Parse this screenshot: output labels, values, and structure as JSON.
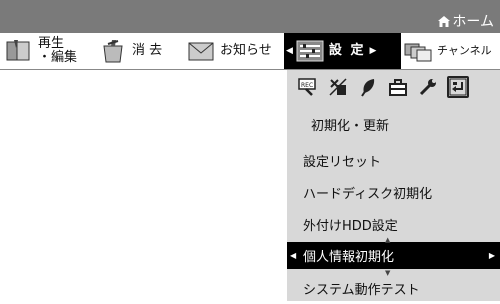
{
  "header": {
    "home_label": "ホーム"
  },
  "menubar": {
    "edit_label_1": "再生",
    "edit_label_2": "・編集",
    "delete_label": "消 去",
    "info_label": "お知らせ",
    "settings_label": "設 定",
    "channel_label": "チャンネル"
  },
  "submenu": {
    "icons": [
      "rec-icon",
      "antenna-icon",
      "leaf-icon",
      "toolbox-icon",
      "wrench-icon",
      "return-icon"
    ],
    "section_title": "初期化・更新",
    "items": [
      {
        "label": "設定リセット"
      },
      {
        "label": "ハードディスク初期化"
      },
      {
        "label": "外付けHDD設定"
      },
      {
        "label": "個人情報初期化"
      },
      {
        "label": "システム動作テスト"
      }
    ],
    "selected_index": 3
  }
}
